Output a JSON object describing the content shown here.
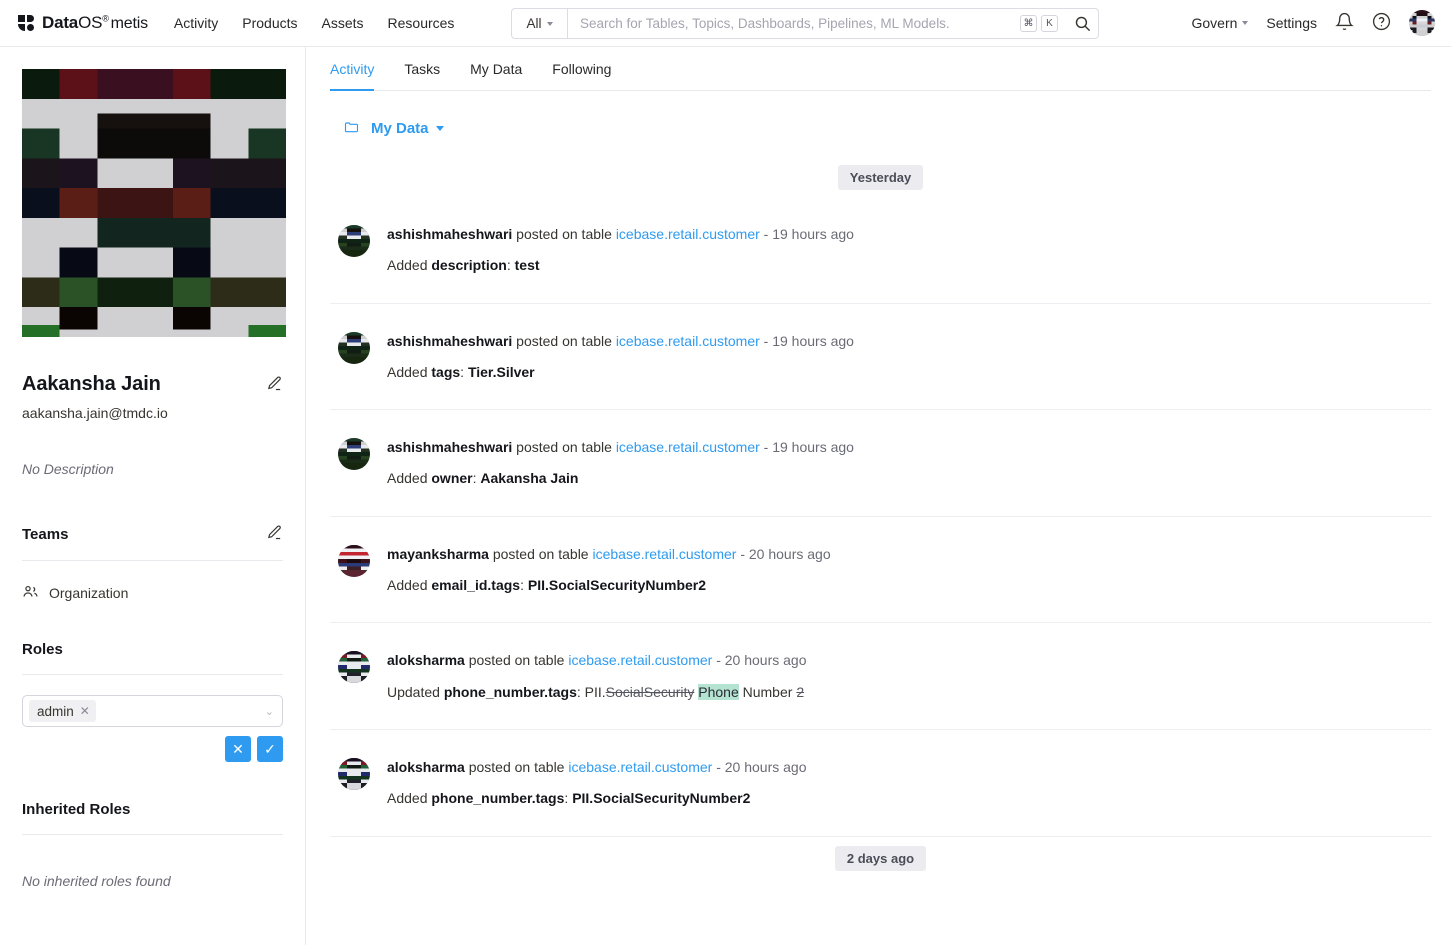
{
  "header": {
    "brand": {
      "data": "Data",
      "os": "OS",
      "reg": "®",
      "sub": "metis"
    },
    "nav": [
      {
        "label": "Activity"
      },
      {
        "label": "Products"
      },
      {
        "label": "Assets"
      },
      {
        "label": "Resources"
      }
    ],
    "search": {
      "scope": "All",
      "placeholder": "Search for Tables, Topics, Dashboards, Pipelines, ML Models.",
      "value": "",
      "kbd_cmd": "⌘",
      "kbd_key": "K",
      "search_icon": "search-icon"
    },
    "right": [
      {
        "label": "Govern",
        "has_caret": true
      },
      {
        "label": "Settings",
        "has_caret": false
      }
    ],
    "bell_icon": "bell-icon",
    "help_icon": "help-circle-icon",
    "avatar_icon": "user-avatar"
  },
  "sidebar": {
    "profile_image": "user-profile-identicon",
    "name": "Aakansha Jain",
    "email": "aakansha.jain@tmdc.io",
    "description_placeholder": "No Description",
    "edit_icon": "pencil-icon",
    "teams": {
      "title": "Teams",
      "items": [
        {
          "label": "Organization",
          "icon": "users-icon"
        }
      ]
    },
    "roles": {
      "title": "Roles",
      "chips": [
        {
          "label": "admin",
          "remove_icon": "close-icon"
        }
      ],
      "dropdown_icon": "chevron-down-icon",
      "cancel_label": "✕",
      "confirm_label": "✓"
    },
    "inherited_roles": {
      "title": "Inherited Roles",
      "empty": "No inherited roles found"
    }
  },
  "main": {
    "tabs": [
      {
        "label": "Activity",
        "active": true
      },
      {
        "label": "Tasks",
        "active": false
      },
      {
        "label": "My Data",
        "active": false
      },
      {
        "label": "Following",
        "active": false
      }
    ],
    "filter": {
      "icon": "folder-icon",
      "label": "My Data",
      "caret_icon": "chevron-down-icon"
    },
    "feed": [
      {
        "kind": "date",
        "label": "Yesterday"
      },
      {
        "kind": "entry",
        "avatar": "avatar-ashishmaheshwari",
        "user": "ashishmaheshwari",
        "action": " posted on table ",
        "table": "icebase.retail.customer",
        "time": " - 19 hours ago",
        "detail_prefix": "Added ",
        "detail_field": "description",
        "detail_sep": ": ",
        "detail_value": "test"
      },
      {
        "kind": "entry",
        "avatar": "avatar-ashishmaheshwari",
        "user": "ashishmaheshwari",
        "action": " posted on table ",
        "table": "icebase.retail.customer",
        "time": " - 19 hours ago",
        "detail_prefix": "Added ",
        "detail_field": "tags",
        "detail_sep": ": ",
        "detail_value": "Tier.Silver"
      },
      {
        "kind": "entry",
        "avatar": "avatar-ashishmaheshwari",
        "user": "ashishmaheshwari",
        "action": " posted on table ",
        "table": "icebase.retail.customer",
        "time": " - 19 hours ago",
        "detail_prefix": "Added ",
        "detail_field": "owner",
        "detail_sep": ": ",
        "detail_value": "Aakansha Jain"
      },
      {
        "kind": "entry",
        "avatar": "avatar-mayanksharma",
        "user": "mayanksharma",
        "action": " posted on table ",
        "table": "icebase.retail.customer",
        "time": " - 20 hours ago",
        "detail_prefix": "Added ",
        "detail_field": "email_id.tags",
        "detail_sep": ": ",
        "detail_value": "PII.SocialSecurityNumber2"
      },
      {
        "kind": "entry-diff",
        "avatar": "avatar-aloksharma",
        "user": "aloksharma",
        "action": " posted on table ",
        "table": "icebase.retail.customer",
        "time": " - 20 hours ago",
        "detail_prefix": "Updated ",
        "detail_field": "phone_number.tags",
        "detail_sep": ": ",
        "diff": [
          {
            "text": "PII.",
            "type": "plain"
          },
          {
            "text": "SocialSecurity",
            "type": "removed"
          },
          {
            "text": " ",
            "type": "plain"
          },
          {
            "text": "Phone",
            "type": "added"
          },
          {
            "text": " Number ",
            "type": "plain"
          },
          {
            "text": "2",
            "type": "removed"
          }
        ]
      },
      {
        "kind": "entry",
        "avatar": "avatar-aloksharma",
        "user": "aloksharma",
        "action": " posted on table ",
        "table": "icebase.retail.customer",
        "time": " - 20 hours ago",
        "detail_prefix": "Added ",
        "detail_field": "phone_number.tags",
        "detail_sep": ": ",
        "detail_value": "PII.SocialSecurityNumber2"
      },
      {
        "kind": "date",
        "label": "2 days ago"
      }
    ]
  },
  "colors": {
    "accent": "#2e9bf0",
    "text": "#37352f",
    "muted": "#6b6b76",
    "diff_added_bg": "#b4e3d2",
    "pill_bg": "#ececf0",
    "border": "#e8e8ed"
  }
}
